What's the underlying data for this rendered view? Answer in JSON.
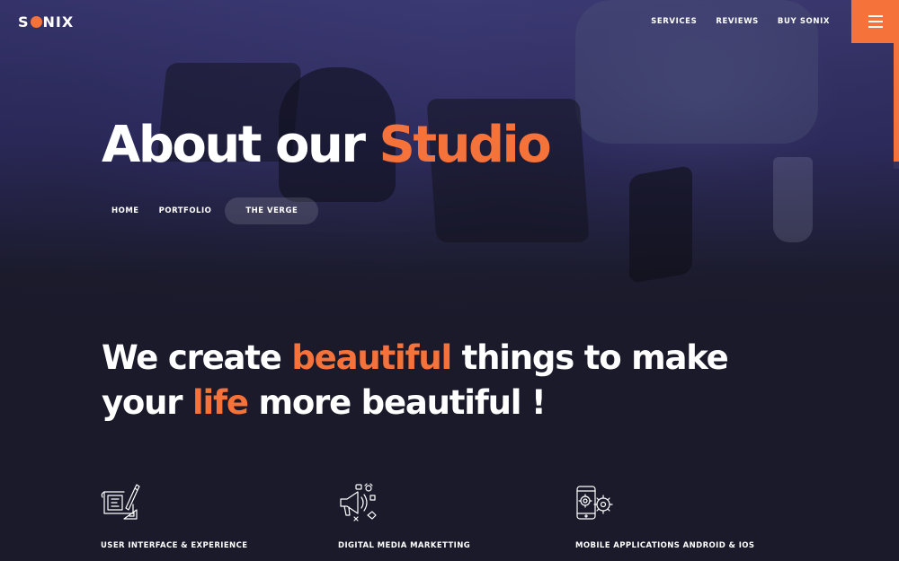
{
  "brand": {
    "logo_prefix": "S",
    "logo_suffix": "NIX",
    "accent_color": "#f5723a"
  },
  "nav": {
    "items": [
      "SERVICES",
      "REVIEWS",
      "BUY SONIX"
    ],
    "menu_icon": "hamburger-icon"
  },
  "hero": {
    "title_part1": "About our",
    "title_part2": "Studio",
    "breadcrumb": [
      "HOME",
      "PORTFOLIO",
      "THE VERGE"
    ]
  },
  "tagline": {
    "w1": "We create",
    "w2": "beautiful",
    "w3": "things to make",
    "w4": "your",
    "w5": "life",
    "w6": "more beautiful !"
  },
  "services": [
    {
      "label": "USER INTERFACE & EXPERIENCE",
      "icon": "design-blueprint-icon"
    },
    {
      "label": "DIGITAL MEDIA MARKETTING",
      "icon": "megaphone-marketing-icon"
    },
    {
      "label": "MOBILE APPLICATIONS ANDROID & IOS",
      "icon": "mobile-gears-icon"
    }
  ]
}
